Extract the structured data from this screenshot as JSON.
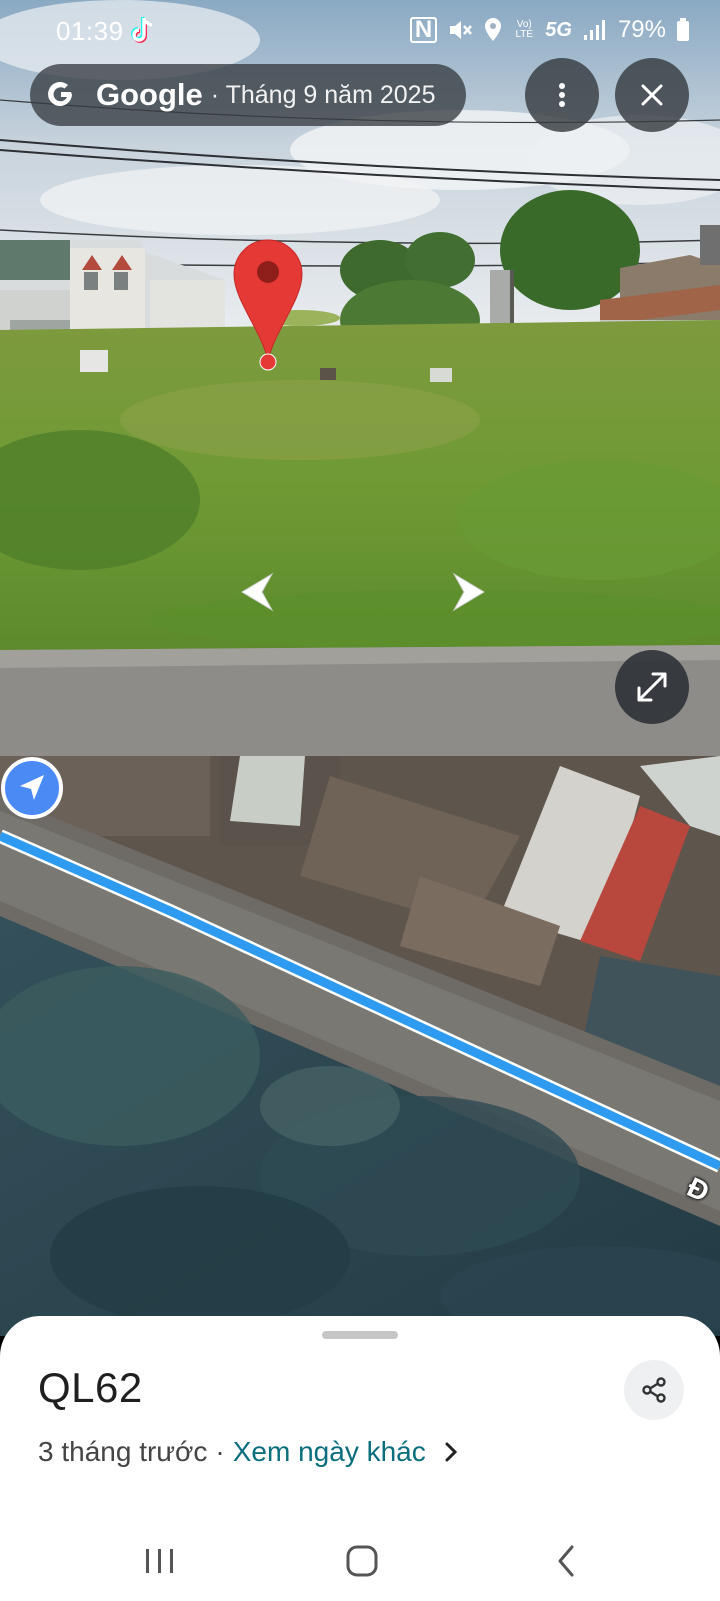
{
  "status_bar": {
    "time": "01:39",
    "battery": "79%",
    "network": "5G",
    "volte": "Vo) LTE"
  },
  "street_view": {
    "brand": "Google",
    "date": "· Tháng 9 năm 2025",
    "more_icon": "more-vert-icon",
    "close_icon": "close-icon",
    "expand_icon": "expand-icon"
  },
  "map": {
    "road_label": "Đ",
    "colors": {
      "route": "#2f9bf0",
      "marker": "#4a8af4"
    }
  },
  "place": {
    "title": "QL62",
    "age": "3 tháng trước",
    "separator": "·",
    "other_dates_link": "Xem ngày khác"
  },
  "colors": {
    "pin": "#e53935",
    "link": "#0b6e7e"
  }
}
